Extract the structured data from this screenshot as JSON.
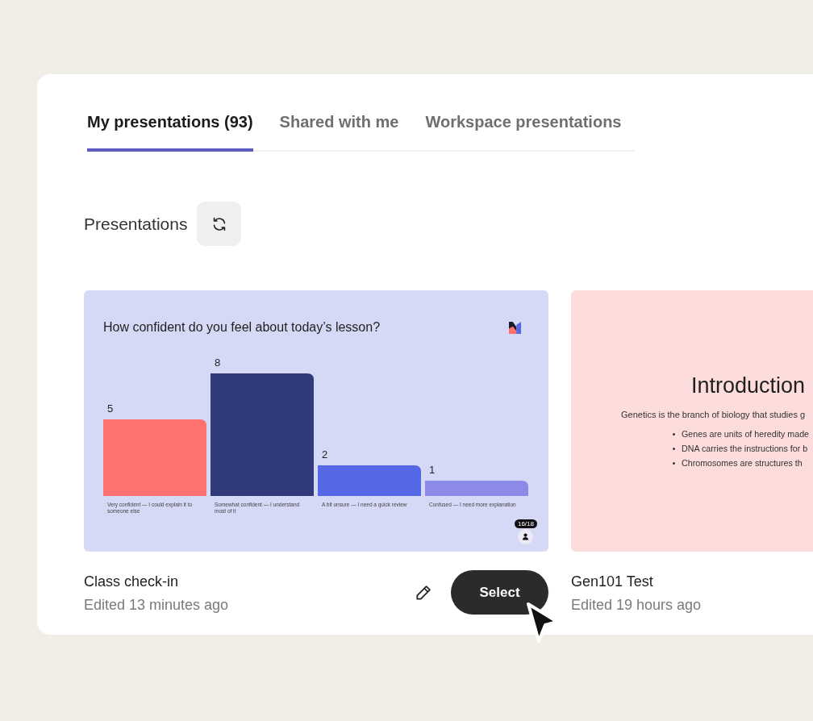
{
  "tabs": [
    {
      "label": "My presentations (93)",
      "selected": true
    },
    {
      "label": "Shared with me",
      "selected": false
    },
    {
      "label": "Workspace presentations",
      "selected": false
    }
  ],
  "section": {
    "title": "Presentations"
  },
  "presentations": [
    {
      "kind": "chart",
      "slide": {
        "question": "How confident do you feel about today’s lesson?",
        "chart_data": {
          "type": "bar",
          "categories": [
            "Very confident — I could explain it to someone else",
            "Somewhat confident — I understand most of it",
            "A bit unsure — I need a quick review",
            "Confused — I need more explanation"
          ],
          "values": [
            5,
            8,
            2,
            1
          ],
          "data_labels": true
        },
        "badge": "16/18"
      },
      "name": "Class check-in",
      "edited": "Edited 13 minutes ago",
      "actions": {
        "select": "Select"
      }
    },
    {
      "kind": "text",
      "slide": {
        "title": "Introduction",
        "paragraph": "Genetics is the branch of biology that studies g",
        "bullets": [
          "Genes are units of heredity made",
          "DNA carries the instructions for b",
          "Chromosomes are structures th"
        ]
      },
      "name": "Gen101 Test",
      "edited": "Edited 19 hours ago"
    }
  ]
}
